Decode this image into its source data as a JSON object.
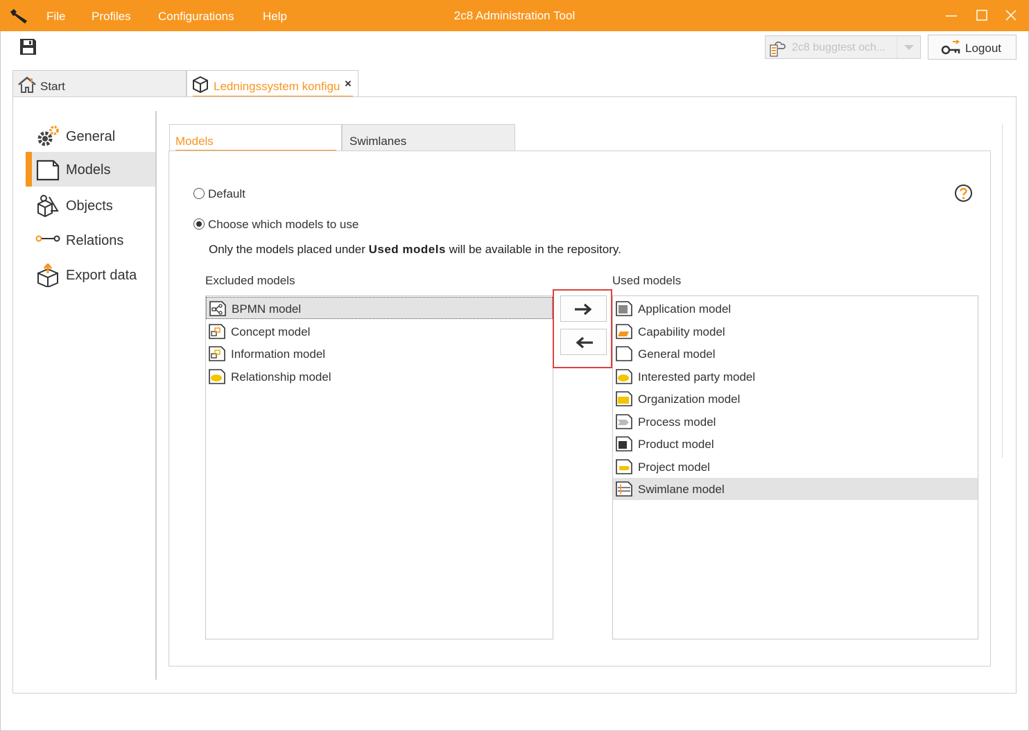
{
  "window": {
    "title": "2c8 Administration Tool",
    "menu": [
      "File",
      "Profiles",
      "Configurations",
      "Help"
    ]
  },
  "toolbar": {
    "repository": "2c8 buggtest och...",
    "logout_label": "Logout"
  },
  "tabs": {
    "start_label": "Start",
    "config_label": "Ledningssystem konfiguration",
    "close_glyph": "×"
  },
  "sidebar": {
    "items": [
      {
        "label": "General",
        "icon": "gear-icon"
      },
      {
        "label": "Models",
        "icon": "model-page-icon",
        "active": true
      },
      {
        "label": "Objects",
        "icon": "objects-icon"
      },
      {
        "label": "Relations",
        "icon": "relations-icon"
      },
      {
        "label": "Export data",
        "icon": "export-icon"
      }
    ]
  },
  "inner_tabs": {
    "models_label": "Models",
    "swimlanes_label": "Swimlanes"
  },
  "options": {
    "default_label": "Default",
    "choose_label": "Choose which models to use",
    "selected": "choose",
    "info_prefix": "Only the models placed under ",
    "info_bold": "Used models",
    "info_suffix": " will be available in the repository."
  },
  "excluded": {
    "title": "Excluded models",
    "items": [
      "BPMN model",
      "Concept model",
      "Information model",
      "Relationship model"
    ],
    "selected_index": 0
  },
  "used": {
    "title": "Used models",
    "items": [
      "Application model",
      "Capability model",
      "General model",
      "Interested party model",
      "Organization model",
      "Process model",
      "Product model",
      "Project model",
      "Swimlane model"
    ],
    "selected_index": 8
  },
  "colors": {
    "accent": "#f7961e",
    "highlight_frame": "#e04040"
  }
}
